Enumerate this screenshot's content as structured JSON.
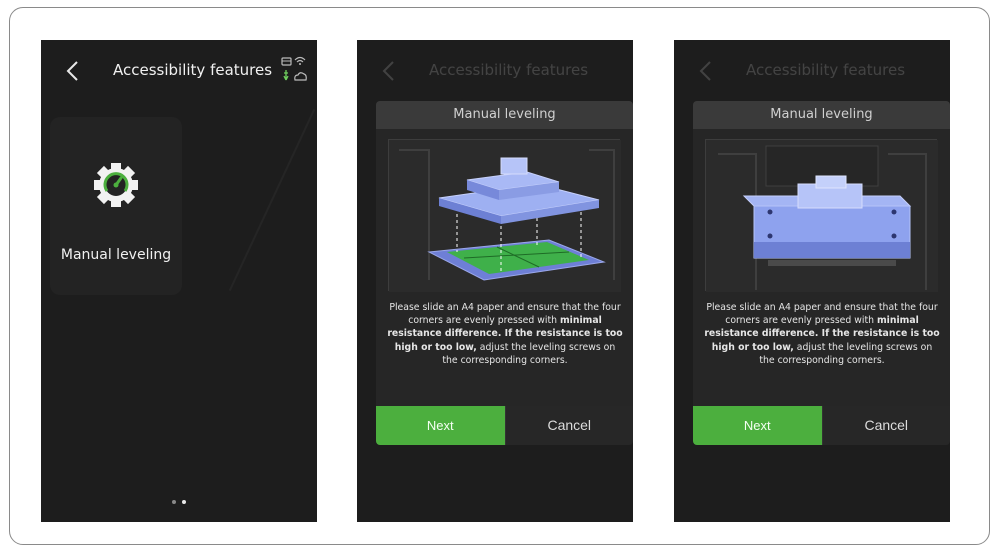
{
  "header": {
    "title": "Accessibility features"
  },
  "menu": {
    "items": [
      {
        "label": "Manual leveling",
        "icon": "gear-gauge-icon"
      }
    ]
  },
  "pager": {
    "pages": 2,
    "active_index": 1
  },
  "dialogs": [
    {
      "title": "Manual leveling",
      "description_parts": [
        {
          "text": "Please slide an A4 paper and ensure that the four corners are evenly pressed with ",
          "bold": false
        },
        {
          "text": "minimal resistance difference. If the resistance is too high or too low,",
          "bold": true
        },
        {
          "text": " adjust the leveling screws on the corresponding corners.",
          "bold": false
        }
      ],
      "next_label": "Next",
      "cancel_label": "Cancel",
      "illustration": "platform-raised-above-plate"
    },
    {
      "title": "Manual leveling",
      "description_parts": [
        {
          "text": "Please slide an A4 paper and ensure that the four corners are evenly pressed with ",
          "bold": false
        },
        {
          "text": "minimal resistance difference. If the resistance is too high or too low,",
          "bold": true
        },
        {
          "text": " adjust the leveling screws on the corresponding corners.",
          "bold": false
        }
      ],
      "next_label": "Next",
      "cancel_label": "Cancel",
      "illustration": "platform-lowered-onto-plate"
    }
  ],
  "colors": {
    "accent": "#4caf3e",
    "screen_bg": "#1d1d1d",
    "dialog_bg": "#262626"
  }
}
